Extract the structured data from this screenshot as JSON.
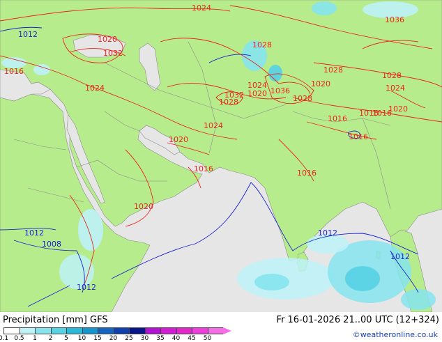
{
  "map": {
    "pressure_unit_note": "",
    "isobars": [
      {
        "label": "1024",
        "color": "red"
      },
      {
        "label": "1020",
        "color": "red"
      },
      {
        "label": "1032",
        "color": "red"
      },
      {
        "label": "1016",
        "color": "red"
      },
      {
        "label": "1024",
        "color": "red"
      },
      {
        "label": "1028",
        "color": "red"
      },
      {
        "label": "1024",
        "color": "red"
      },
      {
        "label": "1020",
        "color": "red"
      },
      {
        "label": "1016",
        "color": "red"
      },
      {
        "label": "1020",
        "color": "red"
      },
      {
        "label": "1028",
        "color": "red"
      },
      {
        "label": "1024",
        "color": "red"
      },
      {
        "label": "1020",
        "color": "red"
      },
      {
        "label": "1032",
        "color": "red"
      },
      {
        "label": "1036",
        "color": "red"
      },
      {
        "label": "1028",
        "color": "red"
      },
      {
        "label": "1020",
        "color": "red"
      },
      {
        "label": "1028",
        "color": "red"
      },
      {
        "label": "1028",
        "color": "red"
      },
      {
        "label": "1024",
        "color": "red"
      },
      {
        "label": "1020",
        "color": "red"
      },
      {
        "label": "1016",
        "color": "red"
      },
      {
        "label": "1016",
        "color": "red"
      },
      {
        "label": "1016",
        "color": "red"
      },
      {
        "label": "1016",
        "color": "red"
      },
      {
        "label": "1016",
        "color": "red"
      },
      {
        "label": "1036",
        "color": "red"
      },
      {
        "label": "1012",
        "color": "blue"
      },
      {
        "label": "1012",
        "color": "blue"
      },
      {
        "label": "1008",
        "color": "blue"
      },
      {
        "label": "1012",
        "color": "blue"
      },
      {
        "label": "1012",
        "color": "blue"
      },
      {
        "label": "1012",
        "color": "blue"
      }
    ]
  },
  "footer": {
    "title": "Precipitation [mm]  GFS",
    "datetime": "Fr 16-01-2026 21..00 UTC (12+324)",
    "credit": "©weatheronline.co.uk"
  },
  "legend": {
    "ticks": [
      "0.1",
      "0.5",
      "1",
      "2",
      "5",
      "10",
      "15",
      "20",
      "25",
      "30",
      "35",
      "40",
      "45",
      "50"
    ],
    "colors": [
      "#ffffff",
      "#bdf2f7",
      "#86e4ee",
      "#55d2e4",
      "#28b8d8",
      "#1696cf",
      "#1464c4",
      "#0f3fae",
      "#08188c",
      "#b311d6",
      "#d41ad6",
      "#e524cc",
      "#f03dde",
      "#f56ee8"
    ]
  },
  "colors": {
    "land": "#b7ec8c",
    "sea": "#e6e6e6",
    "isobar_high": "#e8261b",
    "isobar_low": "#1a23d0",
    "borders": "#8c8c8c"
  }
}
